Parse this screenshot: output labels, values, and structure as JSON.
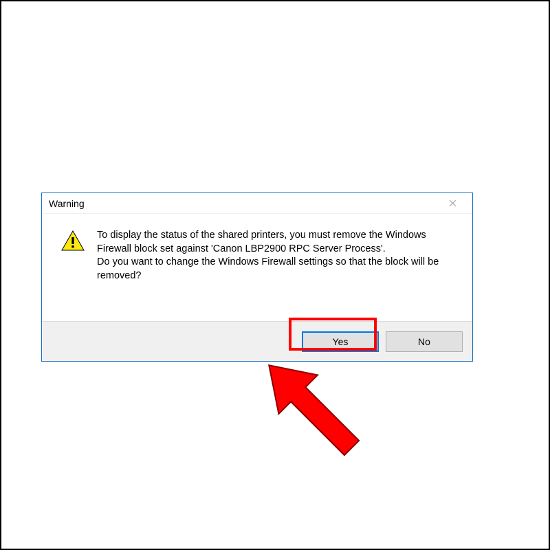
{
  "dialog": {
    "title": "Warning",
    "message": "To display the status of the shared printers, you must remove the Windows Firewall block set against 'Canon LBP2900 RPC Server Process'.\nDo you want to change the Windows Firewall settings so that the block will be removed?",
    "yes_label": "Yes",
    "no_label": "No"
  },
  "colors": {
    "highlight": "#ff0000",
    "dialog_border": "#1a6fc4",
    "default_button_border": "#0078d7"
  }
}
